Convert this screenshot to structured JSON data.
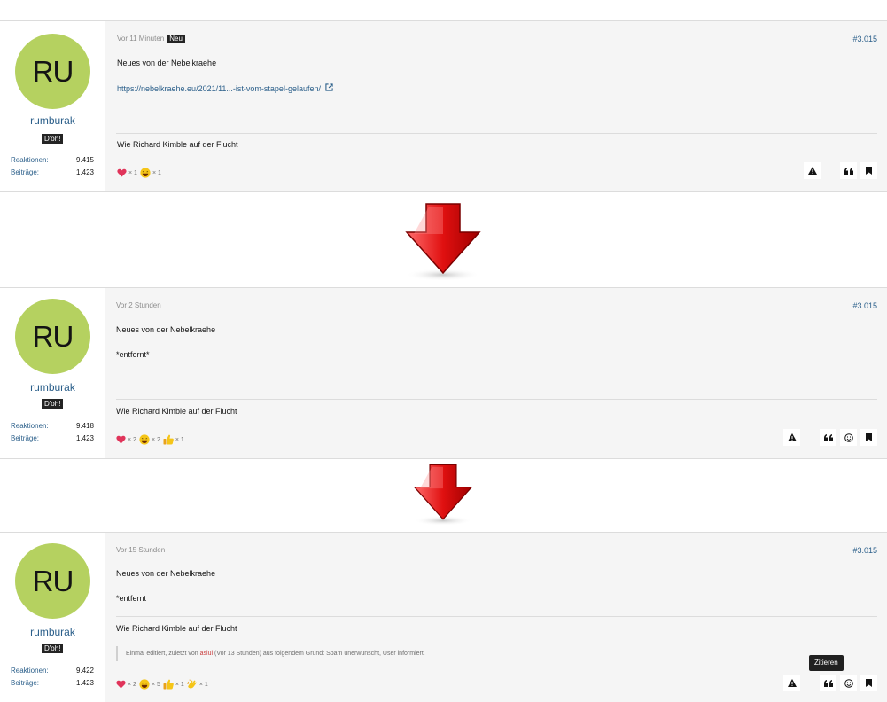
{
  "posts": [
    {
      "avatar_initials": "RU",
      "username": "rumburak",
      "user_title": "D'oh!",
      "stats": [
        {
          "label": "Reaktionen:",
          "value": "9.415"
        },
        {
          "label": "Beiträge:",
          "value": "1.423"
        }
      ],
      "date": "Vor 11 Minuten",
      "new_badge": "Neu",
      "post_number": "#3.015",
      "title_line": "Neues von der Nebelkraehe",
      "body": "https://nebelkraehe.eu/2021/11...-ist-vom-stapel-gelaufen/",
      "signature": "Wie Richard Kimble auf der Flucht",
      "reactions": [
        {
          "icon": "heart-icon",
          "count": "× 1"
        },
        {
          "icon": "laugh-emoji-icon",
          "count": "× 1"
        }
      ]
    },
    {
      "avatar_initials": "RU",
      "username": "rumburak",
      "user_title": "D'oh!",
      "stats": [
        {
          "label": "Reaktionen:",
          "value": "9.418"
        },
        {
          "label": "Beiträge:",
          "value": "1.423"
        }
      ],
      "date": "Vor 2 Stunden",
      "post_number": "#3.015",
      "title_line": "Neues von der Nebelkraehe",
      "body": "*entfernt*",
      "signature": "Wie Richard Kimble auf der Flucht",
      "reactions": [
        {
          "icon": "heart-icon",
          "count": "× 2"
        },
        {
          "icon": "laugh-emoji-icon",
          "count": "× 2"
        },
        {
          "icon": "thumbs-up-icon",
          "count": "× 1"
        }
      ]
    },
    {
      "avatar_initials": "RU",
      "username": "rumburak",
      "user_title": "D'oh!",
      "stats": [
        {
          "label": "Reaktionen:",
          "value": "9.422"
        },
        {
          "label": "Beiträge:",
          "value": "1.423"
        }
      ],
      "date": "Vor 15 Stunden",
      "post_number": "#3.015",
      "title_line": "Neues von der Nebelkraehe",
      "body": "*entfernt",
      "signature": "Wie Richard Kimble auf der Flucht",
      "edit_note": {
        "prefix": "Einmal editiert, zuletzt von",
        "moderator": "asiul",
        "suffix": "(Vor 13 Stunden) aus folgendem Grund: Spam unerwünscht, User informiert."
      },
      "reactions": [
        {
          "icon": "heart-icon",
          "count": "× 2"
        },
        {
          "icon": "laugh-emoji-icon",
          "count": "× 5"
        },
        {
          "icon": "thumbs-up-icon",
          "count": "× 1"
        },
        {
          "icon": "clapping-hands-icon",
          "count": "× 1"
        }
      ],
      "tooltip": "Zitieren"
    }
  ],
  "icons": {
    "report": "report-warning-icon",
    "quote": "quote-icon",
    "react": "smiley-icon",
    "bookmark": "bookmark-icon",
    "external": "external-link-icon",
    "arrow": "red-down-arrow-icon"
  },
  "colors": {
    "avatar_bg": "#b5d160",
    "link": "#2b5f8a",
    "post_bg": "#f5f5f5",
    "arrow_red": "#e01010",
    "heart": "#e0345a",
    "emoji_yellow": "#f5c518"
  }
}
